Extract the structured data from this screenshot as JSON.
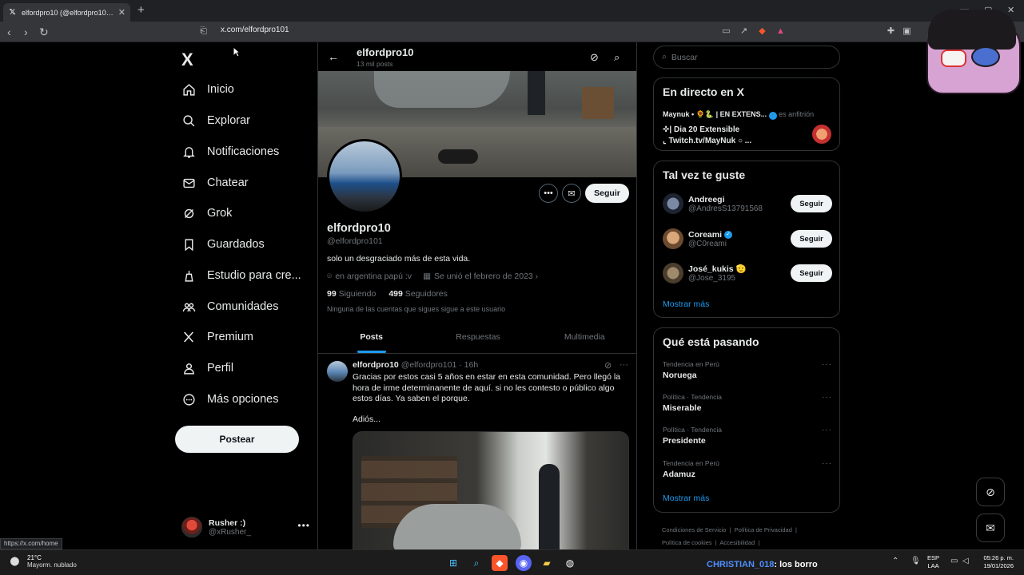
{
  "browser": {
    "tab_title": "elfordpro10 (@elfordpro101) / X",
    "tab_close": "✕",
    "new_tab": "+",
    "url": "x.com/elfordpro101",
    "status_url": "https://x.com/home"
  },
  "leftnav": {
    "logo": "X",
    "items": [
      {
        "label": "Inicio",
        "icon": "home-icon"
      },
      {
        "label": "Explorar",
        "icon": "search-icon"
      },
      {
        "label": "Notificaciones",
        "icon": "bell-icon"
      },
      {
        "label": "Chatear",
        "icon": "mail-icon"
      },
      {
        "label": "Grok",
        "icon": "grok-icon"
      },
      {
        "label": "Guardados",
        "icon": "bookmark-icon"
      },
      {
        "label": "Estudio para cre...",
        "icon": "studio-icon"
      },
      {
        "label": "Comunidades",
        "icon": "communities-icon"
      },
      {
        "label": "Premium",
        "icon": "x-icon"
      },
      {
        "label": "Perfil",
        "icon": "person-icon"
      },
      {
        "label": "Más opciones",
        "icon": "more-circle-icon"
      }
    ],
    "post_button": "Postear",
    "account": {
      "name": "Rusher :)",
      "handle": "@xRusher_"
    }
  },
  "profile": {
    "header_name": "elfordpro10",
    "header_count": "13 mil posts",
    "display_name": "elfordpro10",
    "handle": "@elfordpro101",
    "bio": "solo un desgraciado más de esta vida.",
    "location": "en argentina papú :v",
    "joined": "Se unió el febrero de 2023",
    "following_count": "99",
    "following_label": "Siguiendo",
    "followers_count": "499",
    "followers_label": "Seguidores",
    "mutual_note": "Ninguna de las cuentas que sigues sigue a este usuario",
    "follow_button": "Seguir",
    "tabs": [
      "Posts",
      "Respuestas",
      "Multimedia"
    ],
    "active_tab": "Posts"
  },
  "tweet": {
    "name": "elfordpro10",
    "handle_time": "@elfordpro101 · 16h",
    "text": "Gracias por estos casi 5 años en estar en esta comunidad. Pero llegó la hora de irme determinanente de aquí. si no les contesto o público algo estos días. Ya saben el porque.",
    "farewell": "Adiós..."
  },
  "right": {
    "search_placeholder": "Buscar",
    "live": {
      "title": "En directo en X",
      "host_line": "Maynuk • 🌻🐍 | EN EXTENS...",
      "host_suffix": "es anfitrión",
      "stream_line1": "| Dia 20 Extensible",
      "stream_line2": "Twitch.tv/MayNuk ○ ..."
    },
    "who_to_follow": {
      "title": "Tal vez te guste",
      "users": [
        {
          "name": "Andreegi",
          "handle": "@AndresS13791568",
          "verified": false
        },
        {
          "name": "Coreami",
          "handle": "@C0reami",
          "verified": true
        },
        {
          "name": "José_kukis 🫡",
          "handle": "@Jose_3195",
          "verified": false
        }
      ],
      "follow_label": "Seguir",
      "show_more": "Mostrar más"
    },
    "trends": {
      "title": "Qué está pasando",
      "items": [
        {
          "context": "Tendencia en Perú",
          "topic": "Noruega"
        },
        {
          "context": "Política · Tendencia",
          "topic": "Miserable"
        },
        {
          "context": "Política · Tendencia",
          "topic": "Presidente"
        },
        {
          "context": "Tendencia en Perú",
          "topic": "Adamuz"
        }
      ],
      "show_more": "Mostrar más"
    },
    "footer": {
      "l1": "Condiciones de Servicio",
      "l2": "Política de Privacidad",
      "l3": "Política de cookies",
      "l4": "Accesibilidad"
    }
  },
  "taskbar": {
    "temp": "21°C",
    "weather": "Mayorm. nublado",
    "chat_user": "CHRISTIAN_018",
    "chat_msg": ": los borro",
    "lang1": "ESP",
    "lang2": "LAA",
    "time": "05:26 p. m.",
    "date": "19/01/2026"
  }
}
